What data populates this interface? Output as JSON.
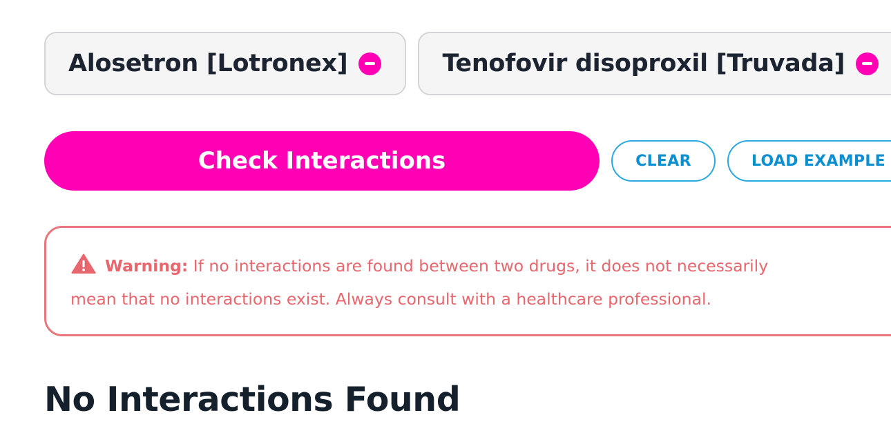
{
  "drugs": [
    {
      "label": "Alosetron [Lotronex]",
      "remove_icon": "minus-circle-icon"
    },
    {
      "label": "Tenofovir disoproxil [Truvada]",
      "remove_icon": "minus-circle-icon"
    }
  ],
  "actions": {
    "check_label": "Check Interactions",
    "clear_label": "CLEAR",
    "load_example_label": "LOAD EXAMPLE"
  },
  "warning": {
    "icon": "warning-triangle-icon",
    "strong": "Warning:",
    "line1": "If no interactions are found between two drugs, it does not necessarily",
    "line2": "mean that no interactions exist. Always consult with a healthcare professional."
  },
  "result": {
    "heading": "No Interactions Found"
  },
  "colors": {
    "accent": "#ff00b4",
    "outline_button": "#2aa8e0",
    "warning": "#e8666d",
    "chip_bg": "#f5f5f6",
    "text_dark": "#14202b"
  }
}
